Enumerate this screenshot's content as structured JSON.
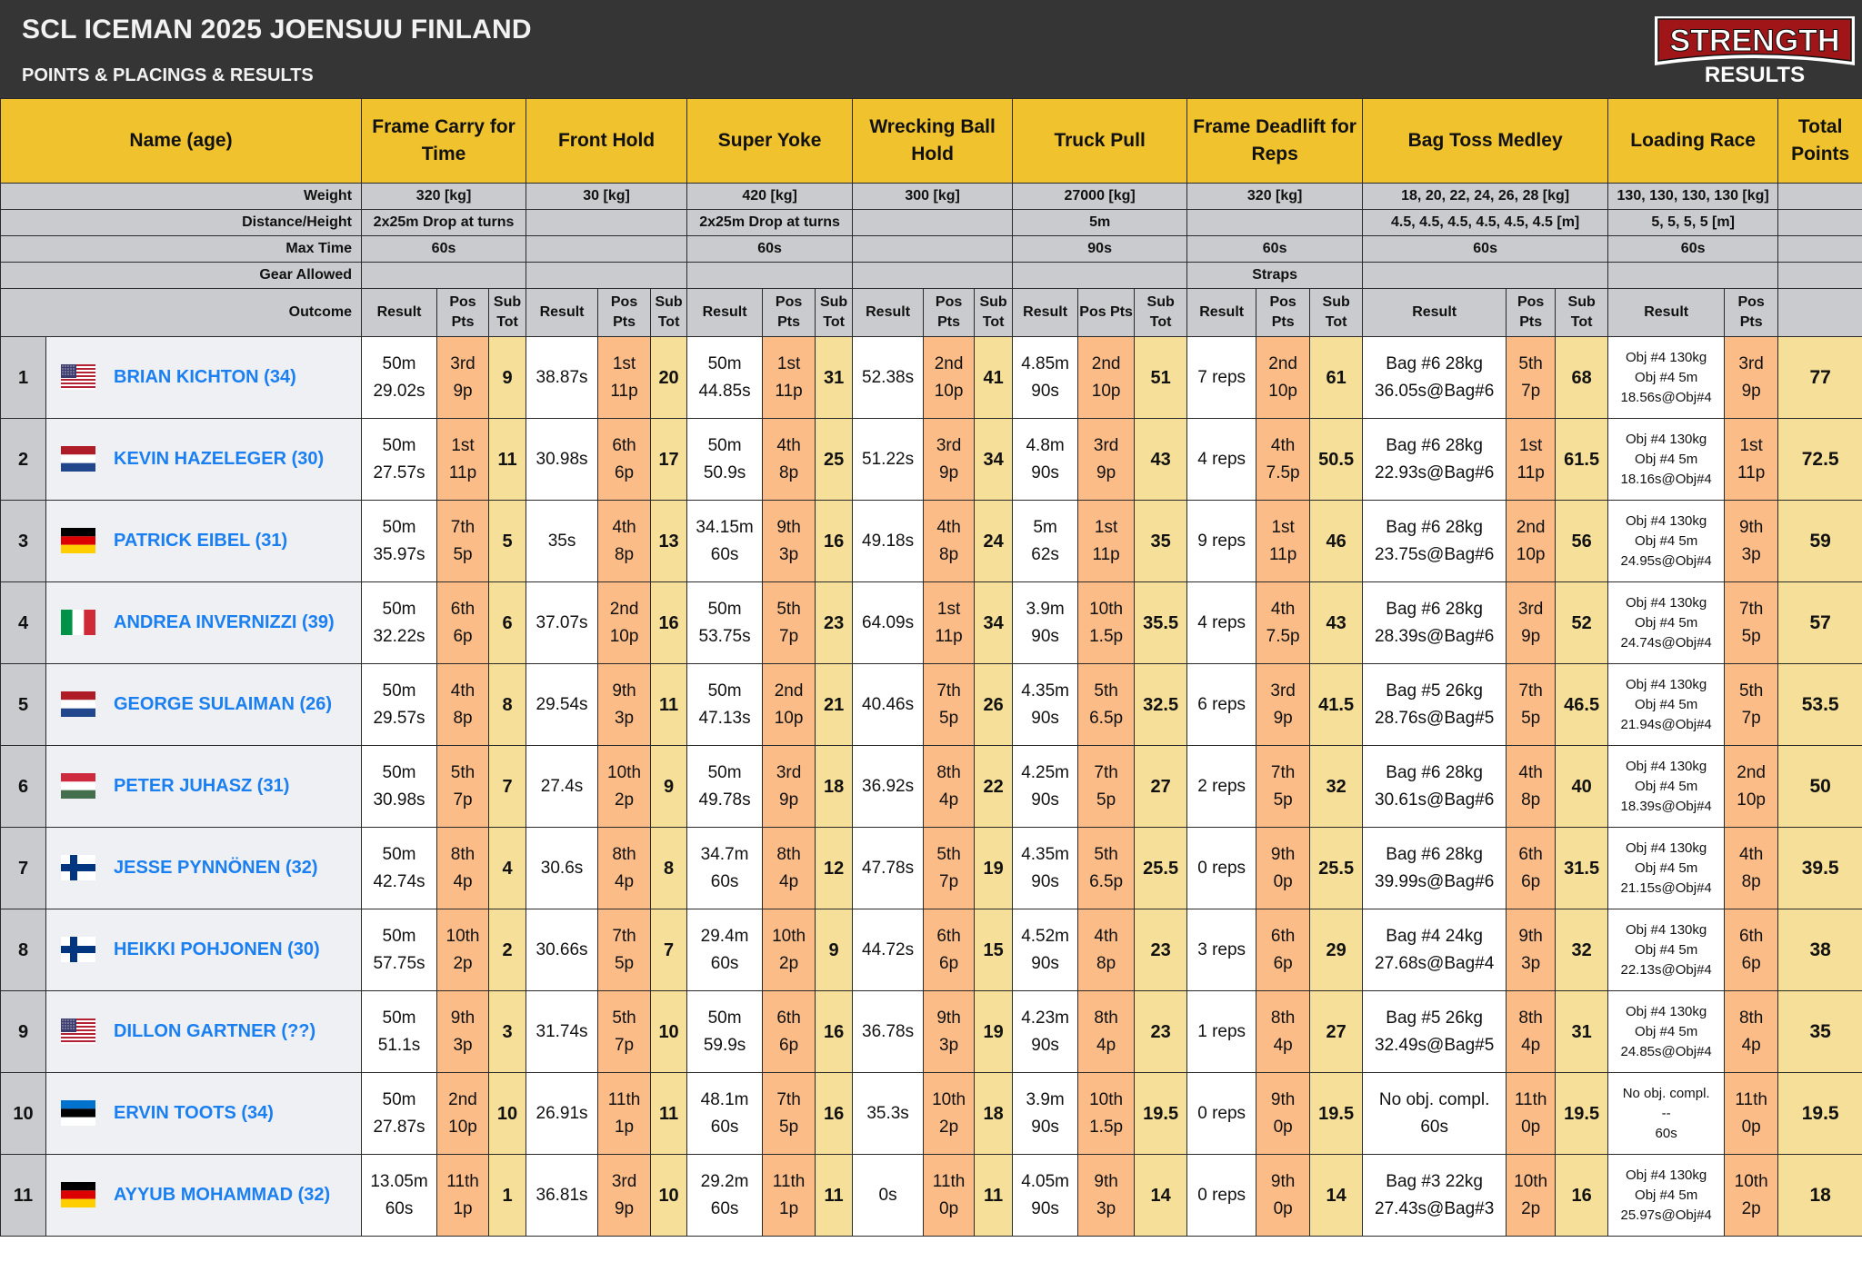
{
  "header": {
    "title": "SCL ICEMAN 2025 JOENSUU FINLAND",
    "subtitle": "POINTS & PLACINGS & RESULTS",
    "logo_top": "STRENGTH",
    "logo_bottom": "RESULTS"
  },
  "colors": {
    "header_bg": "#353535",
    "event_header": "#efc22e",
    "meta_bg": "#c9cbcf",
    "pos_pts": "#fcbc87",
    "sub_tot": "#f6df98",
    "name_link": "#1a7ff0"
  },
  "table": {
    "name_header": "Name (age)",
    "total_header": "Total Points",
    "meta_labels": [
      "Weight",
      "Distance/Height",
      "Max Time",
      "Gear Allowed",
      "Outcome"
    ],
    "subheaders": {
      "result": "Result",
      "pos": "Pos Pts",
      "sub": "Sub Tot"
    },
    "events": [
      {
        "name": "Frame Carry for Time",
        "weight": "320 [kg]",
        "distance": "2x25m Drop at turns",
        "max_time": "60s",
        "gear": ""
      },
      {
        "name": "Front Hold",
        "weight": "30 [kg]",
        "distance": "",
        "max_time": "",
        "gear": ""
      },
      {
        "name": "Super Yoke",
        "weight": "420 [kg]",
        "distance": "2x25m Drop at turns",
        "max_time": "60s",
        "gear": ""
      },
      {
        "name": "Wrecking Ball Hold",
        "weight": "300 [kg]",
        "distance": "",
        "max_time": "",
        "gear": ""
      },
      {
        "name": "Truck Pull",
        "weight": "27000 [kg]",
        "distance": "5m",
        "max_time": "90s",
        "gear": ""
      },
      {
        "name": "Frame Deadlift for Reps",
        "weight": "320 [kg]",
        "distance": "",
        "max_time": "60s",
        "gear": "Straps"
      },
      {
        "name": "Bag Toss Medley",
        "weight": "18, 20, 22, 24, 26, 28 [kg]",
        "distance": "4.5, 4.5, 4.5, 4.5, 4.5, 4.5 [m]",
        "max_time": "60s",
        "gear": ""
      },
      {
        "name": "Loading Race",
        "weight": "130, 130, 130, 130 [kg]",
        "distance": "5, 5, 5, 5 [m]",
        "max_time": "60s",
        "gear": ""
      }
    ]
  },
  "athletes": [
    {
      "rank": "1",
      "flag": "usa",
      "name": "BRIAN KICHTON (34)",
      "events": [
        {
          "r": [
            "50m",
            "29.02s"
          ],
          "p": [
            "3rd",
            "9p"
          ],
          "s": "9"
        },
        {
          "r": [
            "38.87s"
          ],
          "p": [
            "1st",
            "11p"
          ],
          "s": "20"
        },
        {
          "r": [
            "50m",
            "44.85s"
          ],
          "p": [
            "1st",
            "11p"
          ],
          "s": "31"
        },
        {
          "r": [
            "52.38s"
          ],
          "p": [
            "2nd",
            "10p"
          ],
          "s": "41"
        },
        {
          "r": [
            "4.85m",
            "90s"
          ],
          "p": [
            "2nd",
            "10p"
          ],
          "s": "51"
        },
        {
          "r": [
            "7 reps"
          ],
          "p": [
            "2nd",
            "10p"
          ],
          "s": "61"
        },
        {
          "r": [
            "Bag #6 28kg",
            "36.05s@Bag#6"
          ],
          "p": [
            "5th",
            "7p"
          ],
          "s": "68"
        },
        {
          "r": [
            "Obj #4 130kg",
            "Obj #4 5m",
            "18.56s@Obj#4"
          ],
          "p": [
            "3rd",
            "9p"
          ]
        }
      ],
      "total": "77"
    },
    {
      "rank": "2",
      "flag": "netherlands",
      "name": "KEVIN HAZELEGER (30)",
      "events": [
        {
          "r": [
            "50m",
            "27.57s"
          ],
          "p": [
            "1st",
            "11p"
          ],
          "s": "11"
        },
        {
          "r": [
            "30.98s"
          ],
          "p": [
            "6th",
            "6p"
          ],
          "s": "17"
        },
        {
          "r": [
            "50m",
            "50.9s"
          ],
          "p": [
            "4th",
            "8p"
          ],
          "s": "25"
        },
        {
          "r": [
            "51.22s"
          ],
          "p": [
            "3rd",
            "9p"
          ],
          "s": "34"
        },
        {
          "r": [
            "4.8m",
            "90s"
          ],
          "p": [
            "3rd",
            "9p"
          ],
          "s": "43"
        },
        {
          "r": [
            "4 reps"
          ],
          "p": [
            "4th",
            "7.5p"
          ],
          "s": "50.5"
        },
        {
          "r": [
            "Bag #6 28kg",
            "22.93s@Bag#6"
          ],
          "p": [
            "1st",
            "11p"
          ],
          "s": "61.5"
        },
        {
          "r": [
            "Obj #4 130kg",
            "Obj #4 5m",
            "18.16s@Obj#4"
          ],
          "p": [
            "1st",
            "11p"
          ]
        }
      ],
      "total": "72.5"
    },
    {
      "rank": "3",
      "flag": "germany",
      "name": "PATRICK EIBEL (31)",
      "events": [
        {
          "r": [
            "50m",
            "35.97s"
          ],
          "p": [
            "7th",
            "5p"
          ],
          "s": "5"
        },
        {
          "r": [
            "35s"
          ],
          "p": [
            "4th",
            "8p"
          ],
          "s": "13"
        },
        {
          "r": [
            "34.15m",
            "60s"
          ],
          "p": [
            "9th",
            "3p"
          ],
          "s": "16"
        },
        {
          "r": [
            "49.18s"
          ],
          "p": [
            "4th",
            "8p"
          ],
          "s": "24"
        },
        {
          "r": [
            "5m",
            "62s"
          ],
          "p": [
            "1st",
            "11p"
          ],
          "s": "35"
        },
        {
          "r": [
            "9 reps"
          ],
          "p": [
            "1st",
            "11p"
          ],
          "s": "46"
        },
        {
          "r": [
            "Bag #6 28kg",
            "23.75s@Bag#6"
          ],
          "p": [
            "2nd",
            "10p"
          ],
          "s": "56"
        },
        {
          "r": [
            "Obj #4 130kg",
            "Obj #4 5m",
            "24.95s@Obj#4"
          ],
          "p": [
            "9th",
            "3p"
          ]
        }
      ],
      "total": "59"
    },
    {
      "rank": "4",
      "flag": "italy",
      "name": "ANDREA INVERNIZZI (39)",
      "events": [
        {
          "r": [
            "50m",
            "32.22s"
          ],
          "p": [
            "6th",
            "6p"
          ],
          "s": "6"
        },
        {
          "r": [
            "37.07s"
          ],
          "p": [
            "2nd",
            "10p"
          ],
          "s": "16"
        },
        {
          "r": [
            "50m",
            "53.75s"
          ],
          "p": [
            "5th",
            "7p"
          ],
          "s": "23"
        },
        {
          "r": [
            "64.09s"
          ],
          "p": [
            "1st",
            "11p"
          ],
          "s": "34"
        },
        {
          "r": [
            "3.9m",
            "90s"
          ],
          "p": [
            "10th",
            "1.5p"
          ],
          "s": "35.5"
        },
        {
          "r": [
            "4 reps"
          ],
          "p": [
            "4th",
            "7.5p"
          ],
          "s": "43"
        },
        {
          "r": [
            "Bag #6 28kg",
            "28.39s@Bag#6"
          ],
          "p": [
            "3rd",
            "9p"
          ],
          "s": "52"
        },
        {
          "r": [
            "Obj #4 130kg",
            "Obj #4 5m",
            "24.74s@Obj#4"
          ],
          "p": [
            "7th",
            "5p"
          ]
        }
      ],
      "total": "57"
    },
    {
      "rank": "5",
      "flag": "netherlands",
      "name": "GEORGE SULAIMAN (26)",
      "events": [
        {
          "r": [
            "50m",
            "29.57s"
          ],
          "p": [
            "4th",
            "8p"
          ],
          "s": "8"
        },
        {
          "r": [
            "29.54s"
          ],
          "p": [
            "9th",
            "3p"
          ],
          "s": "11"
        },
        {
          "r": [
            "50m",
            "47.13s"
          ],
          "p": [
            "2nd",
            "10p"
          ],
          "s": "21"
        },
        {
          "r": [
            "40.46s"
          ],
          "p": [
            "7th",
            "5p"
          ],
          "s": "26"
        },
        {
          "r": [
            "4.35m",
            "90s"
          ],
          "p": [
            "5th",
            "6.5p"
          ],
          "s": "32.5"
        },
        {
          "r": [
            "6 reps"
          ],
          "p": [
            "3rd",
            "9p"
          ],
          "s": "41.5"
        },
        {
          "r": [
            "Bag #5 26kg",
            "28.76s@Bag#5"
          ],
          "p": [
            "7th",
            "5p"
          ],
          "s": "46.5"
        },
        {
          "r": [
            "Obj #4 130kg",
            "Obj #4 5m",
            "21.94s@Obj#4"
          ],
          "p": [
            "5th",
            "7p"
          ]
        }
      ],
      "total": "53.5"
    },
    {
      "rank": "6",
      "flag": "hungary",
      "name": "PETER JUHASZ (31)",
      "events": [
        {
          "r": [
            "50m",
            "30.98s"
          ],
          "p": [
            "5th",
            "7p"
          ],
          "s": "7"
        },
        {
          "r": [
            "27.4s"
          ],
          "p": [
            "10th",
            "2p"
          ],
          "s": "9"
        },
        {
          "r": [
            "50m",
            "49.78s"
          ],
          "p": [
            "3rd",
            "9p"
          ],
          "s": "18"
        },
        {
          "r": [
            "36.92s"
          ],
          "p": [
            "8th",
            "4p"
          ],
          "s": "22"
        },
        {
          "r": [
            "4.25m",
            "90s"
          ],
          "p": [
            "7th",
            "5p"
          ],
          "s": "27"
        },
        {
          "r": [
            "2 reps"
          ],
          "p": [
            "7th",
            "5p"
          ],
          "s": "32"
        },
        {
          "r": [
            "Bag #6 28kg",
            "30.61s@Bag#6"
          ],
          "p": [
            "4th",
            "8p"
          ],
          "s": "40"
        },
        {
          "r": [
            "Obj #4 130kg",
            "Obj #4 5m",
            "18.39s@Obj#4"
          ],
          "p": [
            "2nd",
            "10p"
          ]
        }
      ],
      "total": "50"
    },
    {
      "rank": "7",
      "flag": "finland",
      "name": "JESSE PYNNÖNEN (32)",
      "events": [
        {
          "r": [
            "50m",
            "42.74s"
          ],
          "p": [
            "8th",
            "4p"
          ],
          "s": "4"
        },
        {
          "r": [
            "30.6s"
          ],
          "p": [
            "8th",
            "4p"
          ],
          "s": "8"
        },
        {
          "r": [
            "34.7m",
            "60s"
          ],
          "p": [
            "8th",
            "4p"
          ],
          "s": "12"
        },
        {
          "r": [
            "47.78s"
          ],
          "p": [
            "5th",
            "7p"
          ],
          "s": "19"
        },
        {
          "r": [
            "4.35m",
            "90s"
          ],
          "p": [
            "5th",
            "6.5p"
          ],
          "s": "25.5"
        },
        {
          "r": [
            "0 reps"
          ],
          "p": [
            "9th",
            "0p"
          ],
          "s": "25.5"
        },
        {
          "r": [
            "Bag #6 28kg",
            "39.99s@Bag#6"
          ],
          "p": [
            "6th",
            "6p"
          ],
          "s": "31.5"
        },
        {
          "r": [
            "Obj #4 130kg",
            "Obj #4 5m",
            "21.15s@Obj#4"
          ],
          "p": [
            "4th",
            "8p"
          ]
        }
      ],
      "total": "39.5"
    },
    {
      "rank": "8",
      "flag": "finland",
      "name": "HEIKKI POHJONEN (30)",
      "events": [
        {
          "r": [
            "50m",
            "57.75s"
          ],
          "p": [
            "10th",
            "2p"
          ],
          "s": "2"
        },
        {
          "r": [
            "30.66s"
          ],
          "p": [
            "7th",
            "5p"
          ],
          "s": "7"
        },
        {
          "r": [
            "29.4m",
            "60s"
          ],
          "p": [
            "10th",
            "2p"
          ],
          "s": "9"
        },
        {
          "r": [
            "44.72s"
          ],
          "p": [
            "6th",
            "6p"
          ],
          "s": "15"
        },
        {
          "r": [
            "4.52m",
            "90s"
          ],
          "p": [
            "4th",
            "8p"
          ],
          "s": "23"
        },
        {
          "r": [
            "3 reps"
          ],
          "p": [
            "6th",
            "6p"
          ],
          "s": "29"
        },
        {
          "r": [
            "Bag #4 24kg",
            "27.68s@Bag#4"
          ],
          "p": [
            "9th",
            "3p"
          ],
          "s": "32"
        },
        {
          "r": [
            "Obj #4 130kg",
            "Obj #4 5m",
            "22.13s@Obj#4"
          ],
          "p": [
            "6th",
            "6p"
          ]
        }
      ],
      "total": "38"
    },
    {
      "rank": "9",
      "flag": "usa",
      "name": "DILLON GARTNER (??)",
      "events": [
        {
          "r": [
            "50m",
            "51.1s"
          ],
          "p": [
            "9th",
            "3p"
          ],
          "s": "3"
        },
        {
          "r": [
            "31.74s"
          ],
          "p": [
            "5th",
            "7p"
          ],
          "s": "10"
        },
        {
          "r": [
            "50m",
            "59.9s"
          ],
          "p": [
            "6th",
            "6p"
          ],
          "s": "16"
        },
        {
          "r": [
            "36.78s"
          ],
          "p": [
            "9th",
            "3p"
          ],
          "s": "19"
        },
        {
          "r": [
            "4.23m",
            "90s"
          ],
          "p": [
            "8th",
            "4p"
          ],
          "s": "23"
        },
        {
          "r": [
            "1 reps"
          ],
          "p": [
            "8th",
            "4p"
          ],
          "s": "27"
        },
        {
          "r": [
            "Bag #5 26kg",
            "32.49s@Bag#5"
          ],
          "p": [
            "8th",
            "4p"
          ],
          "s": "31"
        },
        {
          "r": [
            "Obj #4 130kg",
            "Obj #4 5m",
            "24.85s@Obj#4"
          ],
          "p": [
            "8th",
            "4p"
          ]
        }
      ],
      "total": "35"
    },
    {
      "rank": "10",
      "flag": "estonia",
      "name": "ERVIN TOOTS (34)",
      "events": [
        {
          "r": [
            "50m",
            "27.87s"
          ],
          "p": [
            "2nd",
            "10p"
          ],
          "s": "10"
        },
        {
          "r": [
            "26.91s"
          ],
          "p": [
            "11th",
            "1p"
          ],
          "s": "11"
        },
        {
          "r": [
            "48.1m",
            "60s"
          ],
          "p": [
            "7th",
            "5p"
          ],
          "s": "16"
        },
        {
          "r": [
            "35.3s"
          ],
          "p": [
            "10th",
            "2p"
          ],
          "s": "18"
        },
        {
          "r": [
            "3.9m",
            "90s"
          ],
          "p": [
            "10th",
            "1.5p"
          ],
          "s": "19.5"
        },
        {
          "r": [
            "0 reps"
          ],
          "p": [
            "9th",
            "0p"
          ],
          "s": "19.5"
        },
        {
          "r": [
            "No obj. compl.",
            "60s"
          ],
          "p": [
            "11th",
            "0p"
          ],
          "s": "19.5"
        },
        {
          "r": [
            "No obj. compl.",
            "--",
            "60s"
          ],
          "p": [
            "11th",
            "0p"
          ]
        }
      ],
      "total": "19.5"
    },
    {
      "rank": "11",
      "flag": "germany",
      "name": "AYYUB MOHAMMAD (32)",
      "events": [
        {
          "r": [
            "13.05m",
            "60s"
          ],
          "p": [
            "11th",
            "1p"
          ],
          "s": "1"
        },
        {
          "r": [
            "36.81s"
          ],
          "p": [
            "3rd",
            "9p"
          ],
          "s": "10"
        },
        {
          "r": [
            "29.2m",
            "60s"
          ],
          "p": [
            "11th",
            "1p"
          ],
          "s": "11"
        },
        {
          "r": [
            "0s"
          ],
          "p": [
            "11th",
            "0p"
          ],
          "s": "11"
        },
        {
          "r": [
            "4.05m",
            "90s"
          ],
          "p": [
            "9th",
            "3p"
          ],
          "s": "14"
        },
        {
          "r": [
            "0 reps"
          ],
          "p": [
            "9th",
            "0p"
          ],
          "s": "14"
        },
        {
          "r": [
            "Bag #3 22kg",
            "27.43s@Bag#3"
          ],
          "p": [
            "10th",
            "2p"
          ],
          "s": "16"
        },
        {
          "r": [
            "Obj #4 130kg",
            "Obj #4 5m",
            "25.97s@Obj#4"
          ],
          "p": [
            "10th",
            "2p"
          ]
        }
      ],
      "total": "18"
    }
  ]
}
